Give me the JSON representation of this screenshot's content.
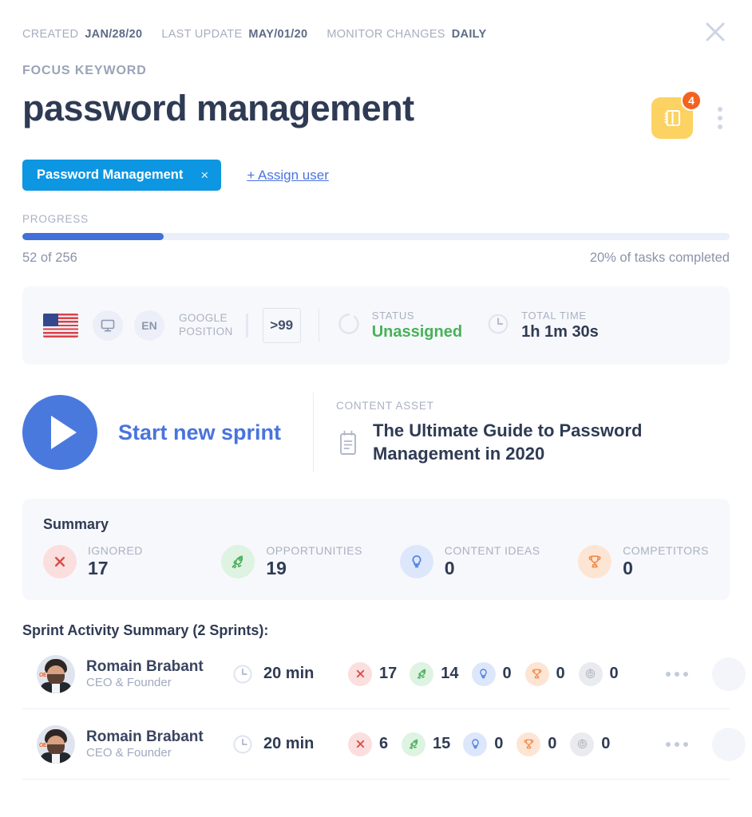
{
  "header": {
    "created_label": "CREATED",
    "created_value": "JAN/28/20",
    "last_update_label": "LAST UPDATE",
    "last_update_value": "MAY/01/20",
    "monitor_label": "MONITOR CHANGES",
    "monitor_value": "DAILY",
    "close_icon": "close-icon"
  },
  "keyword": {
    "section_label": "FOCUS KEYWORD",
    "title": "password management",
    "notebook_icon": "notebook-icon",
    "notebook_badge_count": "4",
    "kebab_icon": "more-vertical-icon"
  },
  "tags": {
    "chip_label": "Password Management",
    "chip_remove_icon": "×",
    "assign_link": "+ Assign user"
  },
  "progress": {
    "label": "PROGRESS",
    "percent": 20,
    "count_text": "52 of 256",
    "completed_text": "20% of tasks completed"
  },
  "info_bar": {
    "flag_icon": "us-flag-icon",
    "device_icon": "desktop-icon",
    "language": "EN",
    "google_position_label": "GOOGLE\nPOSITION",
    "google_position_value": ">99",
    "status_icon": "spinner-icon",
    "status_label": "STATUS",
    "status_value": "Unassigned",
    "status_color": "#46b259",
    "time_icon": "clock-icon",
    "time_label": "TOTAL TIME",
    "time_value": "1h 1m 30s"
  },
  "sprint": {
    "play_icon": "play-icon",
    "cta_label": "Start new sprint",
    "asset_label": "CONTENT ASSET",
    "asset_icon": "clipboard-icon",
    "asset_title": "The Ultimate Guide to Password Management in 2020"
  },
  "summary": {
    "title": "Summary",
    "stats": [
      {
        "label": "IGNORED",
        "value": "17",
        "icon": "x-icon",
        "circle": "c-red"
      },
      {
        "label": "OPPORTUNITIES",
        "value": "19",
        "icon": "rocket-icon",
        "circle": "c-green"
      },
      {
        "label": "CONTENT IDEAS",
        "value": "0",
        "icon": "bulb-icon",
        "circle": "c-blue"
      },
      {
        "label": "COMPETITORS",
        "value": "0",
        "icon": "trophy-icon",
        "circle": "c-orange"
      }
    ]
  },
  "activity": {
    "title": "Sprint Activity Summary (2 Sprints):",
    "rows": [
      {
        "avatar": "avatar-romain-brabant",
        "name": "Romain Brabant",
        "role": "CEO & Founder",
        "time": "20 min",
        "metrics": [
          {
            "icon": "x-icon",
            "circle": "c-red",
            "value": "17"
          },
          {
            "icon": "rocket-icon",
            "circle": "c-green",
            "value": "14"
          },
          {
            "icon": "bulb-icon",
            "circle": "c-blue",
            "value": "0"
          },
          {
            "icon": "trophy-icon",
            "circle": "c-orange",
            "value": "0"
          },
          {
            "icon": "target-icon",
            "circle": "c-grey",
            "value": "0"
          }
        ],
        "kebab_icon": "more-horizontal-icon"
      },
      {
        "avatar": "avatar-romain-brabant",
        "name": "Romain Brabant",
        "role": "CEO & Founder",
        "time": "20 min",
        "metrics": [
          {
            "icon": "x-icon",
            "circle": "c-red",
            "value": "6"
          },
          {
            "icon": "rocket-icon",
            "circle": "c-green",
            "value": "15"
          },
          {
            "icon": "bulb-icon",
            "circle": "c-blue",
            "value": "0"
          },
          {
            "icon": "trophy-icon",
            "circle": "c-orange",
            "value": "0"
          },
          {
            "icon": "target-icon",
            "circle": "c-grey",
            "value": "0"
          }
        ],
        "kebab_icon": "more-horizontal-icon"
      }
    ]
  },
  "colors": {
    "accent_blue": "#4070d8",
    "chip_blue": "#0d96e2",
    "link_blue": "#4a74dd",
    "badge_orange": "#f4621f",
    "notebook_yellow": "#fcd263",
    "status_green": "#46b259",
    "card_bg": "#f7f8fb"
  }
}
